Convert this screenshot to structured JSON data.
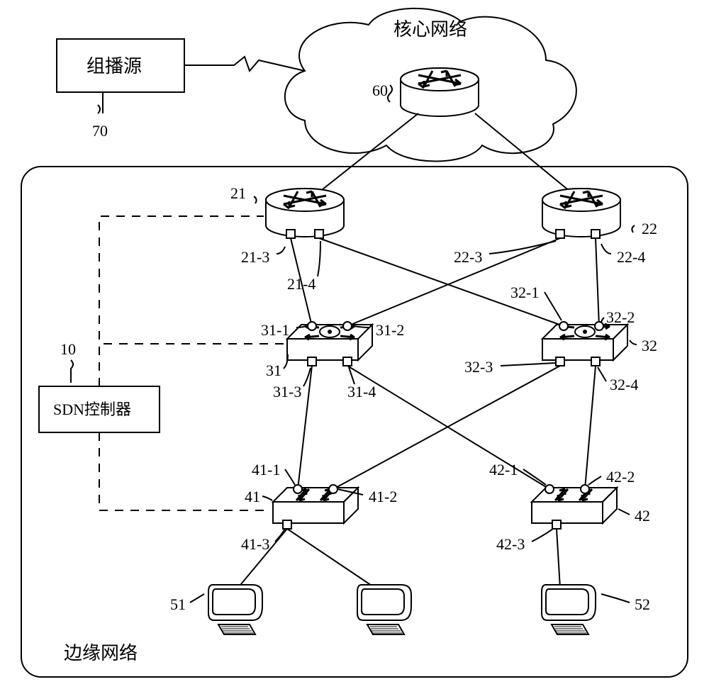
{
  "title_core": "核心网络",
  "multicast_source": "组播源",
  "sdn_controller": "SDN控制器",
  "edge_network": "边缘网络",
  "labels": {
    "source_id": "70",
    "core_id": "60",
    "ctrl_id": "10",
    "r21": "21",
    "r22": "22",
    "r21_3": "21-3",
    "r21_4": "21-4",
    "r22_3": "22-3",
    "r22_4": "22-4",
    "s31": "31",
    "s32": "32",
    "s31_1": "31-1",
    "s31_2": "31-2",
    "s31_3": "31-3",
    "s31_4": "31-4",
    "s32_1": "32-1",
    "s32_2": "32-2",
    "s32_3": "32-3",
    "s32_4": "32-4",
    "s41": "41",
    "s42": "42",
    "s41_1": "41-1",
    "s41_2": "41-2",
    "s41_3": "41-3",
    "s42_1": "42-1",
    "s42_2": "42-2",
    "s42_3": "42-3",
    "h51": "51",
    "h52": "52"
  },
  "chart_data": {
    "type": "diagram",
    "title": "SDN multicast edge network topology",
    "nodes": [
      {
        "id": "70",
        "type": "multicast-source",
        "label": "组播源"
      },
      {
        "id": "60",
        "type": "core-router",
        "label": "核心网络"
      },
      {
        "id": "10",
        "type": "sdn-controller",
        "label": "SDN控制器",
        "region": "edge"
      },
      {
        "id": "21",
        "type": "edge-router",
        "region": "edge",
        "ports": [
          "21-3",
          "21-4"
        ]
      },
      {
        "id": "22",
        "type": "edge-router",
        "region": "edge",
        "ports": [
          "22-3",
          "22-4"
        ]
      },
      {
        "id": "31",
        "type": "sdn-switch",
        "region": "edge",
        "ports": [
          "31-1",
          "31-2",
          "31-3",
          "31-4"
        ]
      },
      {
        "id": "32",
        "type": "sdn-switch",
        "region": "edge",
        "ports": [
          "32-1",
          "32-2",
          "32-3",
          "32-4"
        ]
      },
      {
        "id": "41",
        "type": "access-switch",
        "region": "edge",
        "ports": [
          "41-1",
          "41-2",
          "41-3"
        ]
      },
      {
        "id": "42",
        "type": "access-switch",
        "region": "edge",
        "ports": [
          "42-1",
          "42-2",
          "42-3"
        ]
      },
      {
        "id": "51",
        "type": "host",
        "region": "edge"
      },
      {
        "id": "52",
        "type": "host",
        "region": "edge"
      },
      {
        "id": "h-mid",
        "type": "host",
        "region": "edge"
      }
    ],
    "edges_data": [
      {
        "from": "70",
        "to": "60",
        "style": "wireless"
      },
      {
        "from": "60",
        "to": "21"
      },
      {
        "from": "60",
        "to": "22"
      },
      {
        "from": "21",
        "port": "21-3",
        "to": "31",
        "to_port": "31-1"
      },
      {
        "from": "21",
        "port": "21-4",
        "to": "32",
        "to_port": "32-1"
      },
      {
        "from": "22",
        "port": "22-3",
        "to": "31",
        "to_port": "31-2"
      },
      {
        "from": "22",
        "port": "22-4",
        "to": "32",
        "to_port": "32-2"
      },
      {
        "from": "31",
        "port": "31-3",
        "to": "41",
        "to_port": "41-1"
      },
      {
        "from": "31",
        "port": "31-4",
        "to": "42",
        "to_port": "42-1"
      },
      {
        "from": "32",
        "port": "32-3",
        "to": "41",
        "to_port": "41-2"
      },
      {
        "from": "32",
        "port": "32-4",
        "to": "42",
        "to_port": "42-2"
      },
      {
        "from": "41",
        "port": "41-3",
        "to": "51"
      },
      {
        "from": "41",
        "port": "41-3",
        "to": "h-mid"
      },
      {
        "from": "42",
        "port": "42-3",
        "to": "52"
      }
    ],
    "edges_control": [
      {
        "from": "10",
        "to": "21",
        "style": "dashed"
      },
      {
        "from": "10",
        "to": "31",
        "style": "dashed"
      },
      {
        "from": "10",
        "to": "41",
        "style": "dashed"
      }
    ],
    "region_edge_label": "边缘网络"
  }
}
